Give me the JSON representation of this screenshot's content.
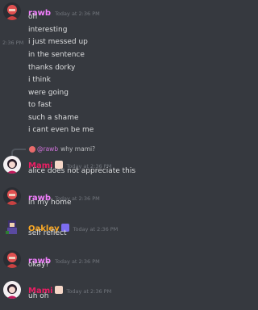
{
  "colors": {
    "background": "#36393f",
    "rawb": "#f47fff",
    "mami": "#e91e63",
    "oakley": "#f9a825",
    "text": "#dcddde",
    "timestamp": "#72767d"
  },
  "messages": [
    {
      "author": "rawb",
      "timestamp": "Today at 2:36 PM",
      "lines": [
        "oh",
        "interesting",
        "i just messed up",
        "in the sentence",
        "thanks dorky",
        "i think",
        "were going",
        "to fast",
        "such a shame",
        "i cant even be me"
      ],
      "hover_timestamp": "2:36 PM"
    },
    {
      "reply_name": "@rawb",
      "reply_text": "why mami?",
      "author": "Mami",
      "timestamp": "Today at 2:36 PM",
      "lines": [
        "alice does not appreciate this"
      ]
    },
    {
      "author": "rawb",
      "timestamp": "Today at 2:36 PM",
      "lines": [
        "in my home"
      ]
    },
    {
      "author": "Oakley",
      "timestamp": "Today at 2:36 PM",
      "lines": [
        "self reflect"
      ]
    },
    {
      "author": "rawb",
      "timestamp": "Today at 2:36 PM",
      "lines": [
        "okay?"
      ]
    },
    {
      "author": "Mami",
      "timestamp": "Today at 2:36 PM",
      "lines": [
        "uh oh"
      ]
    }
  ]
}
